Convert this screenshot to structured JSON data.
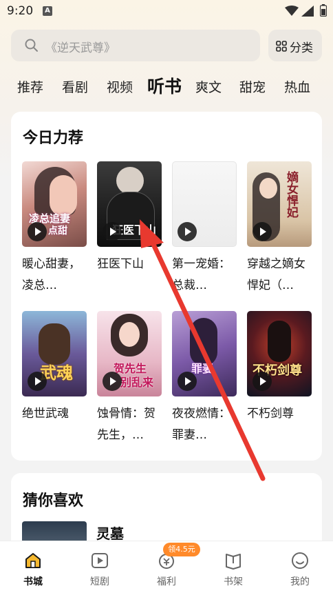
{
  "status_bar": {
    "time": "9:20",
    "badge": "A"
  },
  "search": {
    "placeholder": "《逆天武尊》",
    "category_label": "分类"
  },
  "tabs": [
    {
      "label": "推荐",
      "active": false
    },
    {
      "label": "看剧",
      "active": false
    },
    {
      "label": "视频",
      "active": false
    },
    {
      "label": "听书",
      "active": true
    },
    {
      "label": "爽文",
      "active": false
    },
    {
      "label": "甜宠",
      "active": false
    },
    {
      "label": "热血",
      "active": false
    }
  ],
  "today": {
    "title": "今日力荐",
    "books": [
      {
        "title": "暖心甜妻，凌总…",
        "cover_text": "凌总追妻",
        "cover_sub": "点甜"
      },
      {
        "title": "狂医下山",
        "cover_text": "狂医下山"
      },
      {
        "title": "第一宠婚：总裁…",
        "cover_text": ""
      },
      {
        "title": "穿越之嫡女悍妃（…",
        "cover_text": "嫡女悍妃"
      },
      {
        "title": "绝世武魂",
        "cover_text": "武魂"
      },
      {
        "title": "蚀骨情：贺先生，…",
        "cover_text": "贺先生",
        "cover_sub": "别乱来"
      },
      {
        "title": "夜夜燃情：罪妻…",
        "cover_text": "罪妻"
      },
      {
        "title": "不朽剑尊",
        "cover_text": "不朽剑尊"
      }
    ]
  },
  "guess": {
    "title": "猜你喜欢",
    "item_title": "灵墓"
  },
  "bottom_nav": {
    "items": [
      {
        "label": "书城",
        "active": true
      },
      {
        "label": "短剧",
        "active": false
      },
      {
        "label": "福利",
        "active": false
      },
      {
        "label": "书架",
        "active": false
      },
      {
        "label": "我的",
        "active": false
      }
    ],
    "welfare_badge": "领4.5元"
  },
  "colors": {
    "accent_orange": "#ff8a2a",
    "nav_active": "#f5b82e",
    "annotation_red": "#e8392f"
  }
}
